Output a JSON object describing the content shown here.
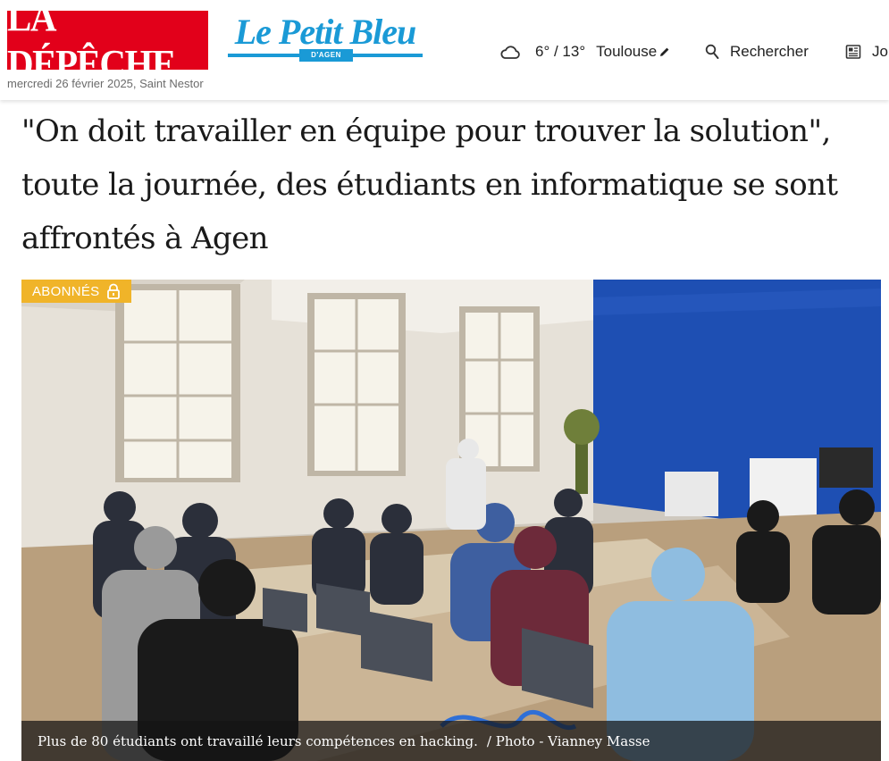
{
  "header": {
    "brand_main": "LA DÉPÊCHE",
    "brand_secondary": "Le Petit Bleu",
    "brand_secondary_sub": "D'AGEN",
    "date": "mercredi 26 février 2025, Saint Nestor",
    "weather": {
      "icon": "cloud-icon",
      "temps": "6° / 13°",
      "city": "Toulouse",
      "edit_icon": "pencil-icon"
    },
    "search_label": "Rechercher",
    "search_icon": "search-icon",
    "journal_label": "Jo",
    "journal_icon": "newspaper-icon"
  },
  "article": {
    "title": "\"On doit travailler en équipe pour trouver la solution\", toute la journée, des étudiants en informatique se sont affrontés à Agen",
    "badge": "ABONNÉS",
    "badge_icon": "lock-icon",
    "caption": "Plus de 80 étudiants ont travaillé leurs compétences en hacking.",
    "credit": "/ Photo - Vianney Masse"
  },
  "colors": {
    "brand_red": "#e2001a",
    "brand_blue": "#1a9ad6",
    "badge": "#f0b429"
  }
}
